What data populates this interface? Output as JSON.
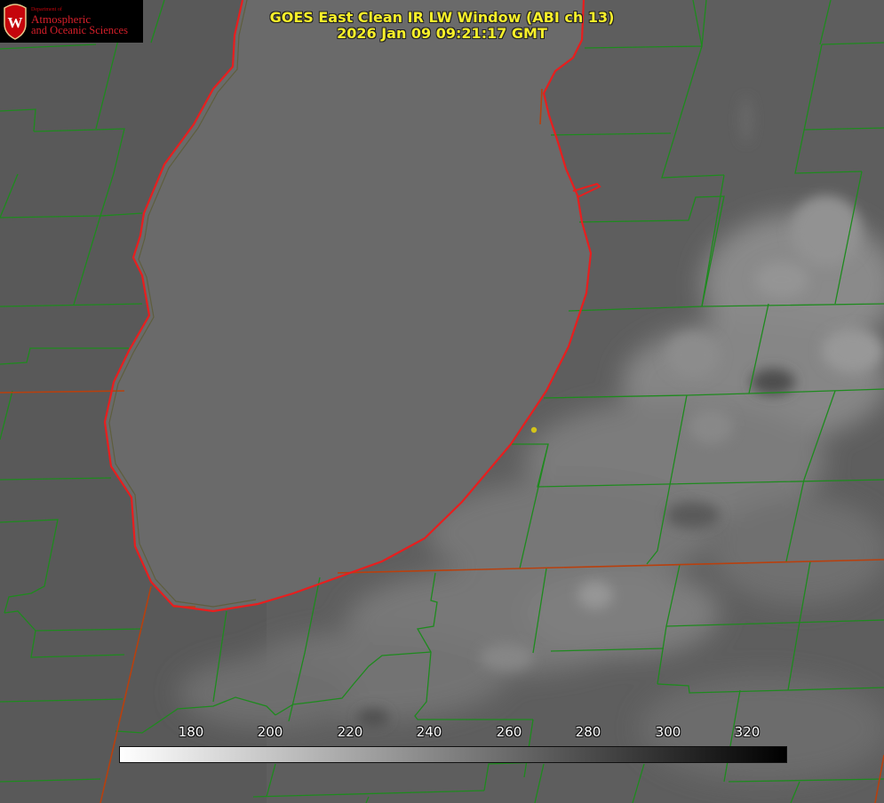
{
  "title": {
    "line1": "GOES East Clean IR LW Window (ABI ch 13)",
    "line2": "2026 Jan 09 09:21:17 GMT"
  },
  "logo": {
    "department": "Department of",
    "line1": "Atmospheric",
    "line2": "and Oceanic Sciences",
    "crest_letter": "W",
    "crest_color": "#c5050c"
  },
  "colorbar": {
    "ticks": [
      "180",
      "200",
      "220",
      "240",
      "260",
      "280",
      "300",
      "320"
    ],
    "gradient_start": "#ffffff",
    "gradient_end": "#000000"
  },
  "colors": {
    "title": "#f7ef2a",
    "county_lines": "#1e8a1e",
    "state_lines": "#b8400e",
    "coastline": "#e81e1e",
    "marker": "#d4c419"
  }
}
